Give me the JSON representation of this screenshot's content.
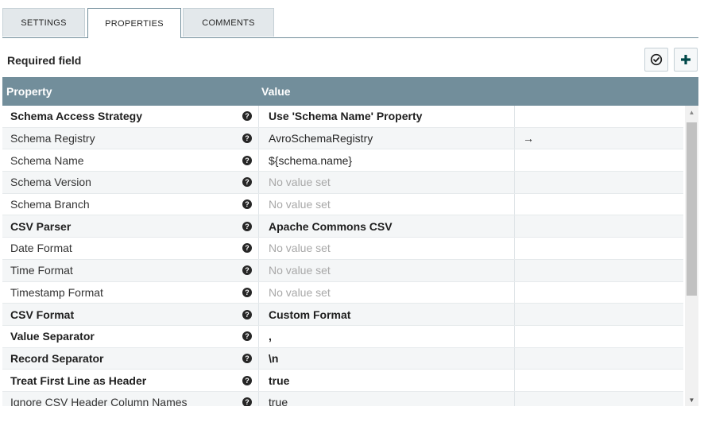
{
  "tabs": [
    {
      "label": "SETTINGS"
    },
    {
      "label": "PROPERTIES"
    },
    {
      "label": "COMMENTS"
    }
  ],
  "required_label": "Required field",
  "table": {
    "headers": {
      "property": "Property",
      "value": "Value"
    },
    "rows": [
      {
        "name": "Schema Access Strategy",
        "value": "Use 'Schema Name' Property",
        "required": true,
        "unset": false,
        "action": ""
      },
      {
        "name": "Schema Registry",
        "value": "AvroSchemaRegistry",
        "required": false,
        "unset": false,
        "action": "→"
      },
      {
        "name": "Schema Name",
        "value": "${schema.name}",
        "required": false,
        "unset": false,
        "action": ""
      },
      {
        "name": "Schema Version",
        "value": "No value set",
        "required": false,
        "unset": true,
        "action": ""
      },
      {
        "name": "Schema Branch",
        "value": "No value set",
        "required": false,
        "unset": true,
        "action": ""
      },
      {
        "name": "CSV Parser",
        "value": "Apache Commons CSV",
        "required": true,
        "unset": false,
        "action": ""
      },
      {
        "name": "Date Format",
        "value": "No value set",
        "required": false,
        "unset": true,
        "action": ""
      },
      {
        "name": "Time Format",
        "value": "No value set",
        "required": false,
        "unset": true,
        "action": ""
      },
      {
        "name": "Timestamp Format",
        "value": "No value set",
        "required": false,
        "unset": true,
        "action": ""
      },
      {
        "name": "CSV Format",
        "value": "Custom Format",
        "required": true,
        "unset": false,
        "action": ""
      },
      {
        "name": "Value Separator",
        "value": ",",
        "required": true,
        "unset": false,
        "action": ""
      },
      {
        "name": "Record Separator",
        "value": "\\n",
        "required": true,
        "unset": false,
        "action": ""
      },
      {
        "name": "Treat First Line as Header",
        "value": "true",
        "required": true,
        "unset": false,
        "action": ""
      },
      {
        "name": "Ignore CSV Header Column Names",
        "value": "true",
        "required": false,
        "unset": false,
        "action": ""
      }
    ]
  },
  "help_glyph": "?",
  "colors": {
    "header_bg": "#728e9b",
    "tab_inactive": "#e3e8eb",
    "accent": "#004849"
  }
}
